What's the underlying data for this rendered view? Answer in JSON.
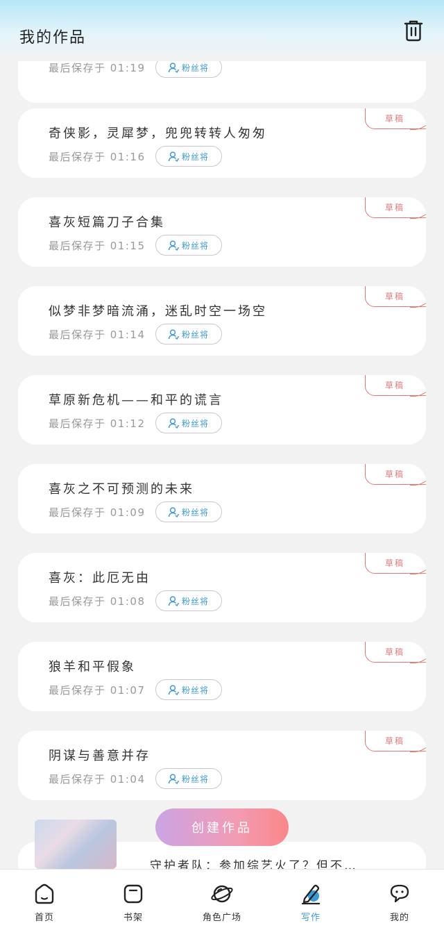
{
  "header": {
    "title": "我的作品"
  },
  "partial_top_card": {
    "save_text": "最后保存于 01:19",
    "fans_label": "粉丝将"
  },
  "works": [
    {
      "title": "奇侠影，灵犀梦，兜兜转转人匆匆",
      "save_text": "最后保存于 01:16",
      "fans_label": "粉丝将",
      "tag": "草稿"
    },
    {
      "title": "喜灰短篇刀子合集",
      "save_text": "最后保存于 01:15",
      "fans_label": "粉丝将",
      "tag": "草稿"
    },
    {
      "title": "似梦非梦暗流涌，迷乱时空一场空",
      "save_text": "最后保存于 01:14",
      "fans_label": "粉丝将",
      "tag": "草稿"
    },
    {
      "title": "草原新危机——和平的谎言",
      "save_text": "最后保存于 01:12",
      "fans_label": "粉丝将",
      "tag": "草稿"
    },
    {
      "title": "喜灰之不可预测的未来",
      "save_text": "最后保存于 01:09",
      "fans_label": "粉丝将",
      "tag": "草稿"
    },
    {
      "title": "喜灰：此厄无由",
      "save_text": "最后保存于 01:08",
      "fans_label": "粉丝将",
      "tag": "草稿"
    },
    {
      "title": "狼羊和平假象",
      "save_text": "最后保存于 01:07",
      "fans_label": "粉丝将",
      "tag": "草稿"
    },
    {
      "title": "阴谋与善意并存",
      "save_text": "最后保存于 01:04",
      "fans_label": "粉丝将",
      "tag": "草稿"
    }
  ],
  "partial_bottom_card": {
    "title": "守护者队：参加综艺火了？但不…"
  },
  "create_button": {
    "label": "创建作品"
  },
  "bottom_nav": [
    {
      "label": "首页",
      "icon": "home-icon"
    },
    {
      "label": "书架",
      "icon": "bookshelf-icon"
    },
    {
      "label": "角色广场",
      "icon": "planet-icon"
    },
    {
      "label": "写作",
      "icon": "pen-icon",
      "active": true
    },
    {
      "label": "我的",
      "icon": "chat-bubble-icon"
    }
  ],
  "colors": {
    "accent_blue": "#3a9ad6",
    "draft_red": "#e07a7a",
    "create_gradient_start": "#cba4e4",
    "create_gradient_end": "#f98888"
  }
}
